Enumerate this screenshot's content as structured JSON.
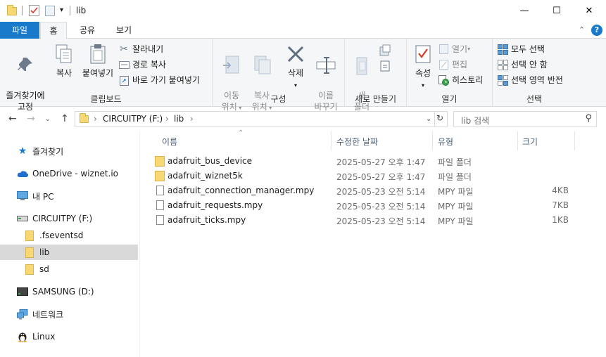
{
  "window": {
    "title": "lib",
    "minimize": "—",
    "maximize": "☐",
    "close": "✕"
  },
  "ribbon_tabs": {
    "file": "파일",
    "home": "홈",
    "share": "공유",
    "view": "보기"
  },
  "ribbon": {
    "clipboard": {
      "pin_label": "즐겨찾기에\n고정",
      "copy_label": "복사",
      "paste_label": "붙여넣기",
      "cut_label": "잘라내기",
      "copy_path_label": "경로 복사",
      "paste_shortcut_label": "바로 가기 붙여넣기",
      "group_label": "클립보드"
    },
    "organize": {
      "move_label": "이동\n위치",
      "copyto_label": "복사\n위치",
      "delete_label": "삭제",
      "rename_label": "이름\n바꾸기",
      "group_label": "구성"
    },
    "new": {
      "new_folder_label": "새\n폴더",
      "group_label": "새로 만들기"
    },
    "open": {
      "properties_label": "속성",
      "open_label": "열기",
      "edit_label": "편집",
      "history_label": "히스토리",
      "group_label": "열기"
    },
    "select": {
      "select_all_label": "모두 선택",
      "select_none_label": "선택 안 함",
      "invert_label": "선택 영역 반전",
      "group_label": "선택"
    }
  },
  "address": {
    "segments": [
      "CIRCUITPY (F:)",
      "lib"
    ],
    "search_placeholder": "lib 검색"
  },
  "sidebar": {
    "items": [
      {
        "label": "즐겨찾기",
        "icon": "star-icon"
      },
      {
        "label": "OneDrive - wiznet.io",
        "icon": "cloud-icon"
      },
      {
        "label": "내 PC",
        "icon": "pc-icon"
      },
      {
        "label": "CIRCUITPY (F:)",
        "icon": "drive-icon"
      },
      {
        "label": ".fseventsd",
        "icon": "folder-icon"
      },
      {
        "label": "lib",
        "icon": "folder-icon"
      },
      {
        "label": "sd",
        "icon": "folder-icon"
      },
      {
        "label": "SAMSUNG (D:)",
        "icon": "drive-icon"
      },
      {
        "label": "네트워크",
        "icon": "network-icon"
      },
      {
        "label": "Linux",
        "icon": "linux-icon"
      }
    ]
  },
  "columns": {
    "name": "이름",
    "date": "수정한 날짜",
    "type": "유형",
    "size": "크기"
  },
  "files": [
    {
      "name": "adafruit_bus_device",
      "date": "2025-05-27 오후 1:47",
      "type": "파일 폴더",
      "size": ""
    },
    {
      "name": "adafruit_wiznet5k",
      "date": "2025-05-27 오후 1:47",
      "type": "파일 폴더",
      "size": ""
    },
    {
      "name": "adafruit_connection_manager.mpy",
      "date": "2025-05-23 오전 5:14",
      "type": "MPY 파일",
      "size": "4KB"
    },
    {
      "name": "adafruit_requests.mpy",
      "date": "2025-05-23 오전 5:14",
      "type": "MPY 파일",
      "size": "7KB"
    },
    {
      "name": "adafruit_ticks.mpy",
      "date": "2025-05-23 오전 5:14",
      "type": "MPY 파일",
      "size": "1KB"
    }
  ],
  "colors": {
    "accent": "#1979ca",
    "folder": "#f8d775",
    "selected": "#d9d9d9"
  }
}
